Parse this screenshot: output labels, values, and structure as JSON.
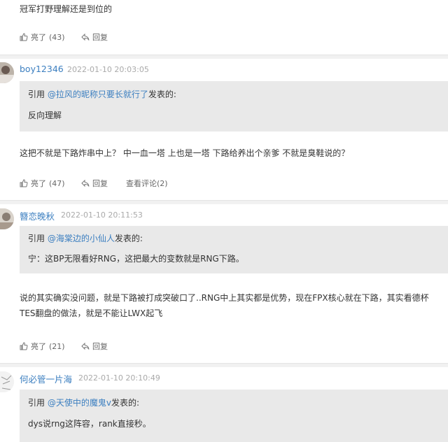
{
  "top_comment": {
    "text": "冠军打野理解还是到位的",
    "like_label": "亮了",
    "like_count": "(43)",
    "reply_label": "回复"
  },
  "comments": [
    {
      "username": "boy12346",
      "time": "2022-01-10 20:03:05",
      "quote_prefix": "引用 ",
      "quote_user": "@拉风的昵称只要长就行了",
      "quote_suffix": "发表的:",
      "quote_text": "反向理解",
      "body": "这把不就是下路炸串中上？ 中一血一塔 上也是一塔 下路给养出个亲爹 不就是臭鞋说的？",
      "like_label": "亮了",
      "like_count": "(47)",
      "reply_label": "回复",
      "view_comments": "查看评论(2)"
    },
    {
      "username": "簪恋晚秋",
      "time": "2022-01-10 20:11:53",
      "quote_prefix": "引用 ",
      "quote_user": "@海棠边的小仙人",
      "quote_suffix": "发表的:",
      "quote_text": "宁：这BP无限看好RNG，这把最大的变数就是RNG下路。",
      "body": "说的其实确实没问题，就是下路被打成突破口了..RNG中上其实都是优势，现在FPX核心就在下路，其实看德杯TES翻盘的做法，就是不能让LWX起飞",
      "like_label": "亮了",
      "like_count": "(21)",
      "reply_label": "回复"
    },
    {
      "username": "何必管一片海",
      "time": "2022-01-10 20:10:49",
      "quote_prefix": "引用 ",
      "quote_user": "@天使中的魔鬼v",
      "quote_suffix": "发表的:",
      "quote_text": "dys说rng这阵容，rank直接秒。"
    }
  ],
  "colors": {
    "link": "#3c7fc0",
    "quote_bg": "#e9e9e9",
    "separator": "#f1f1f1",
    "timestamp": "#aaaaaa"
  }
}
